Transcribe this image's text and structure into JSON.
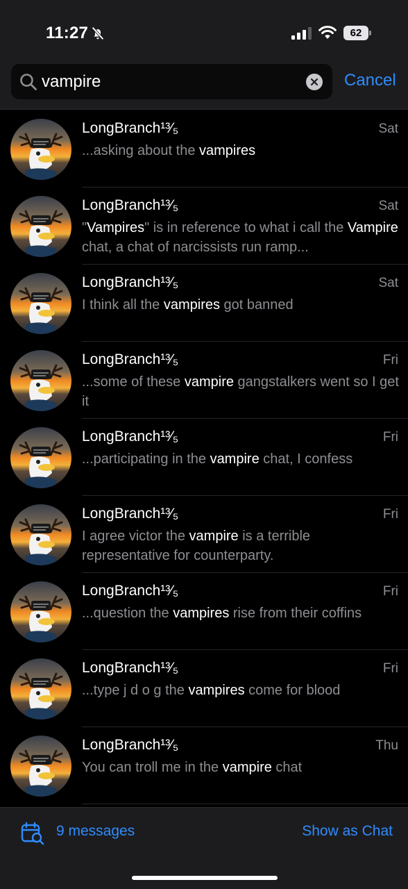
{
  "status_bar": {
    "time": "11:27",
    "battery": "62"
  },
  "search": {
    "query": "vampire",
    "cancel_label": "Cancel"
  },
  "results": [
    {
      "sender": "LongBranch¹³⁄₅",
      "date": "Sat",
      "parts": [
        [
          "...asking about the ",
          false
        ],
        [
          "vampires",
          true
        ]
      ]
    },
    {
      "sender": "LongBranch¹³⁄₅",
      "date": "Sat",
      "parts": [
        [
          "\"",
          false
        ],
        [
          "Vampires",
          true
        ],
        [
          "\" is in reference to what i call the ",
          false
        ],
        [
          "Vampire",
          true
        ],
        [
          " chat, a chat of narcissists run ramp...",
          false
        ]
      ]
    },
    {
      "sender": "LongBranch¹³⁄₅",
      "date": "Sat",
      "parts": [
        [
          "I think all the ",
          false
        ],
        [
          "vampires",
          true
        ],
        [
          " got banned",
          false
        ]
      ]
    },
    {
      "sender": "LongBranch¹³⁄₅",
      "date": "Fri",
      "parts": [
        [
          "...some of these ",
          false
        ],
        [
          "vampire",
          true
        ],
        [
          " gangstalkers went so I get it",
          false
        ]
      ]
    },
    {
      "sender": "LongBranch¹³⁄₅",
      "date": "Fri",
      "parts": [
        [
          "...participating in the ",
          false
        ],
        [
          "vampire",
          true
        ],
        [
          " chat, I confess",
          false
        ]
      ]
    },
    {
      "sender": "LongBranch¹³⁄₅",
      "date": "Fri",
      "parts": [
        [
          "I agree victor the ",
          false
        ],
        [
          "vampire",
          true
        ],
        [
          " is a terrible representative for counterparty.",
          false
        ]
      ]
    },
    {
      "sender": "LongBranch¹³⁄₅",
      "date": "Fri",
      "parts": [
        [
          "...question the ",
          false
        ],
        [
          "vampires",
          true
        ],
        [
          " rise from their coffins",
          false
        ]
      ]
    },
    {
      "sender": "LongBranch¹³⁄₅",
      "date": "Fri",
      "parts": [
        [
          "...type j d o g the ",
          false
        ],
        [
          "vampires",
          true
        ],
        [
          " come for blood",
          false
        ]
      ]
    },
    {
      "sender": "LongBranch¹³⁄₅",
      "date": "Thu",
      "parts": [
        [
          "You can troll me in the ",
          false
        ],
        [
          "vampire",
          true
        ],
        [
          " chat",
          false
        ]
      ]
    }
  ],
  "bottom_bar": {
    "count_label": "9 messages",
    "show_as_chat_label": "Show as Chat"
  },
  "colors": {
    "accent": "#2f8cff",
    "secondary_text": "#8e8e93",
    "bar_background": "#1c1c1e"
  },
  "icons": [
    "bell-off-icon",
    "signal-icon",
    "wifi-icon",
    "search-icon",
    "clear-icon",
    "calendar-search-icon"
  ]
}
